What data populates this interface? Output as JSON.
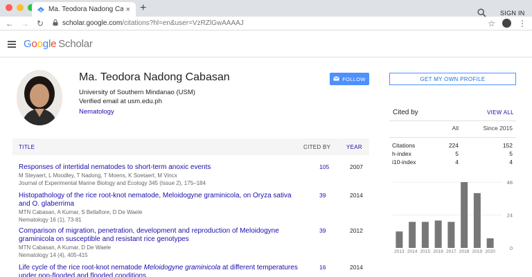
{
  "browser": {
    "tab_title": "Ma. Teodora Nadong Cabasan -",
    "tab_close": "×",
    "new_tab": "+",
    "url_host": "scholar.google.com",
    "url_path": "/citations?hl=en&user=VzRZlGwAAAAJ"
  },
  "header": {
    "logo_google": [
      "G",
      "o",
      "o",
      "g",
      "l",
      "e"
    ],
    "logo_colors": [
      "#4285f4",
      "#ea4335",
      "#fbbc05",
      "#4285f4",
      "#34a853",
      "#ea4335"
    ],
    "logo_product": "Scholar",
    "signin": "SIGN IN"
  },
  "profile": {
    "name": "Ma. Teodora Nadong Cabasan",
    "affiliation": "University of Southern Mindanao (USM)",
    "email": "Verified email at usm.edu.ph",
    "interest": "Nematology",
    "follow_label": "FOLLOW",
    "get_profile_label": "GET MY OWN PROFILE"
  },
  "table": {
    "col_title": "TITLE",
    "col_cited": "CITED BY",
    "col_year": "YEAR"
  },
  "articles": [
    {
      "title": "Responses of intertidal nematodes to short-term anoxic events",
      "authors": "M Steyaert, L Moodley, T Nadong, T Moens, K Soetaert, M Vincx",
      "venue": "Journal of Experimental Marine Biology and Ecology 345 (Issue 2), 175–184",
      "cites": "105",
      "year": "2007"
    },
    {
      "title": "Histopathology of the rice root-knot nematode, Meloidogyne graminicola, on Oryza sativa and O. glaberrima",
      "authors": "MTN Cabasan, A Kumar, S Bellafiore, D De Waele",
      "venue": "Nematology 16 (1), 73-81",
      "cites": "39",
      "year": "2014"
    },
    {
      "title": "Comparison of migration, penetration, development and reproduction of Meloidogyne graminicola on susceptible and resistant rice genotypes",
      "authors": "MTN Cabasan, A Kumar, D De Waele",
      "venue": "Nematology 14 (4), 405-415",
      "cites": "39",
      "year": "2012"
    },
    {
      "title_pre": "Life cycle of the rice root-knot nematode ",
      "title_italic": "Meloidogyne graminicola",
      "title_post": " at different temperatures under non-flooded and flooded conditions",
      "cites": "16",
      "year": "2014"
    }
  ],
  "cited_by": {
    "label": "Cited by",
    "view_all": "VIEW ALL",
    "col_all": "All",
    "col_since": "Since 2015",
    "rows": [
      {
        "label": "Citations",
        "all": "224",
        "since": "152"
      },
      {
        "label": "h-index",
        "all": "5",
        "since": "5"
      },
      {
        "label": "i10-index",
        "all": "4",
        "since": "4"
      }
    ]
  },
  "chart_data": {
    "type": "bar",
    "categories": [
      "2013",
      "2014",
      "2015",
      "2016",
      "2017",
      "2018",
      "2019",
      "2020"
    ],
    "values": [
      12,
      19,
      19,
      20,
      19,
      48,
      40,
      7
    ],
    "y_ticks": [
      0,
      24,
      48
    ],
    "ylim": [
      0,
      48
    ],
    "bar_color": "#777777",
    "title": "",
    "xlabel": "",
    "ylabel": ""
  }
}
